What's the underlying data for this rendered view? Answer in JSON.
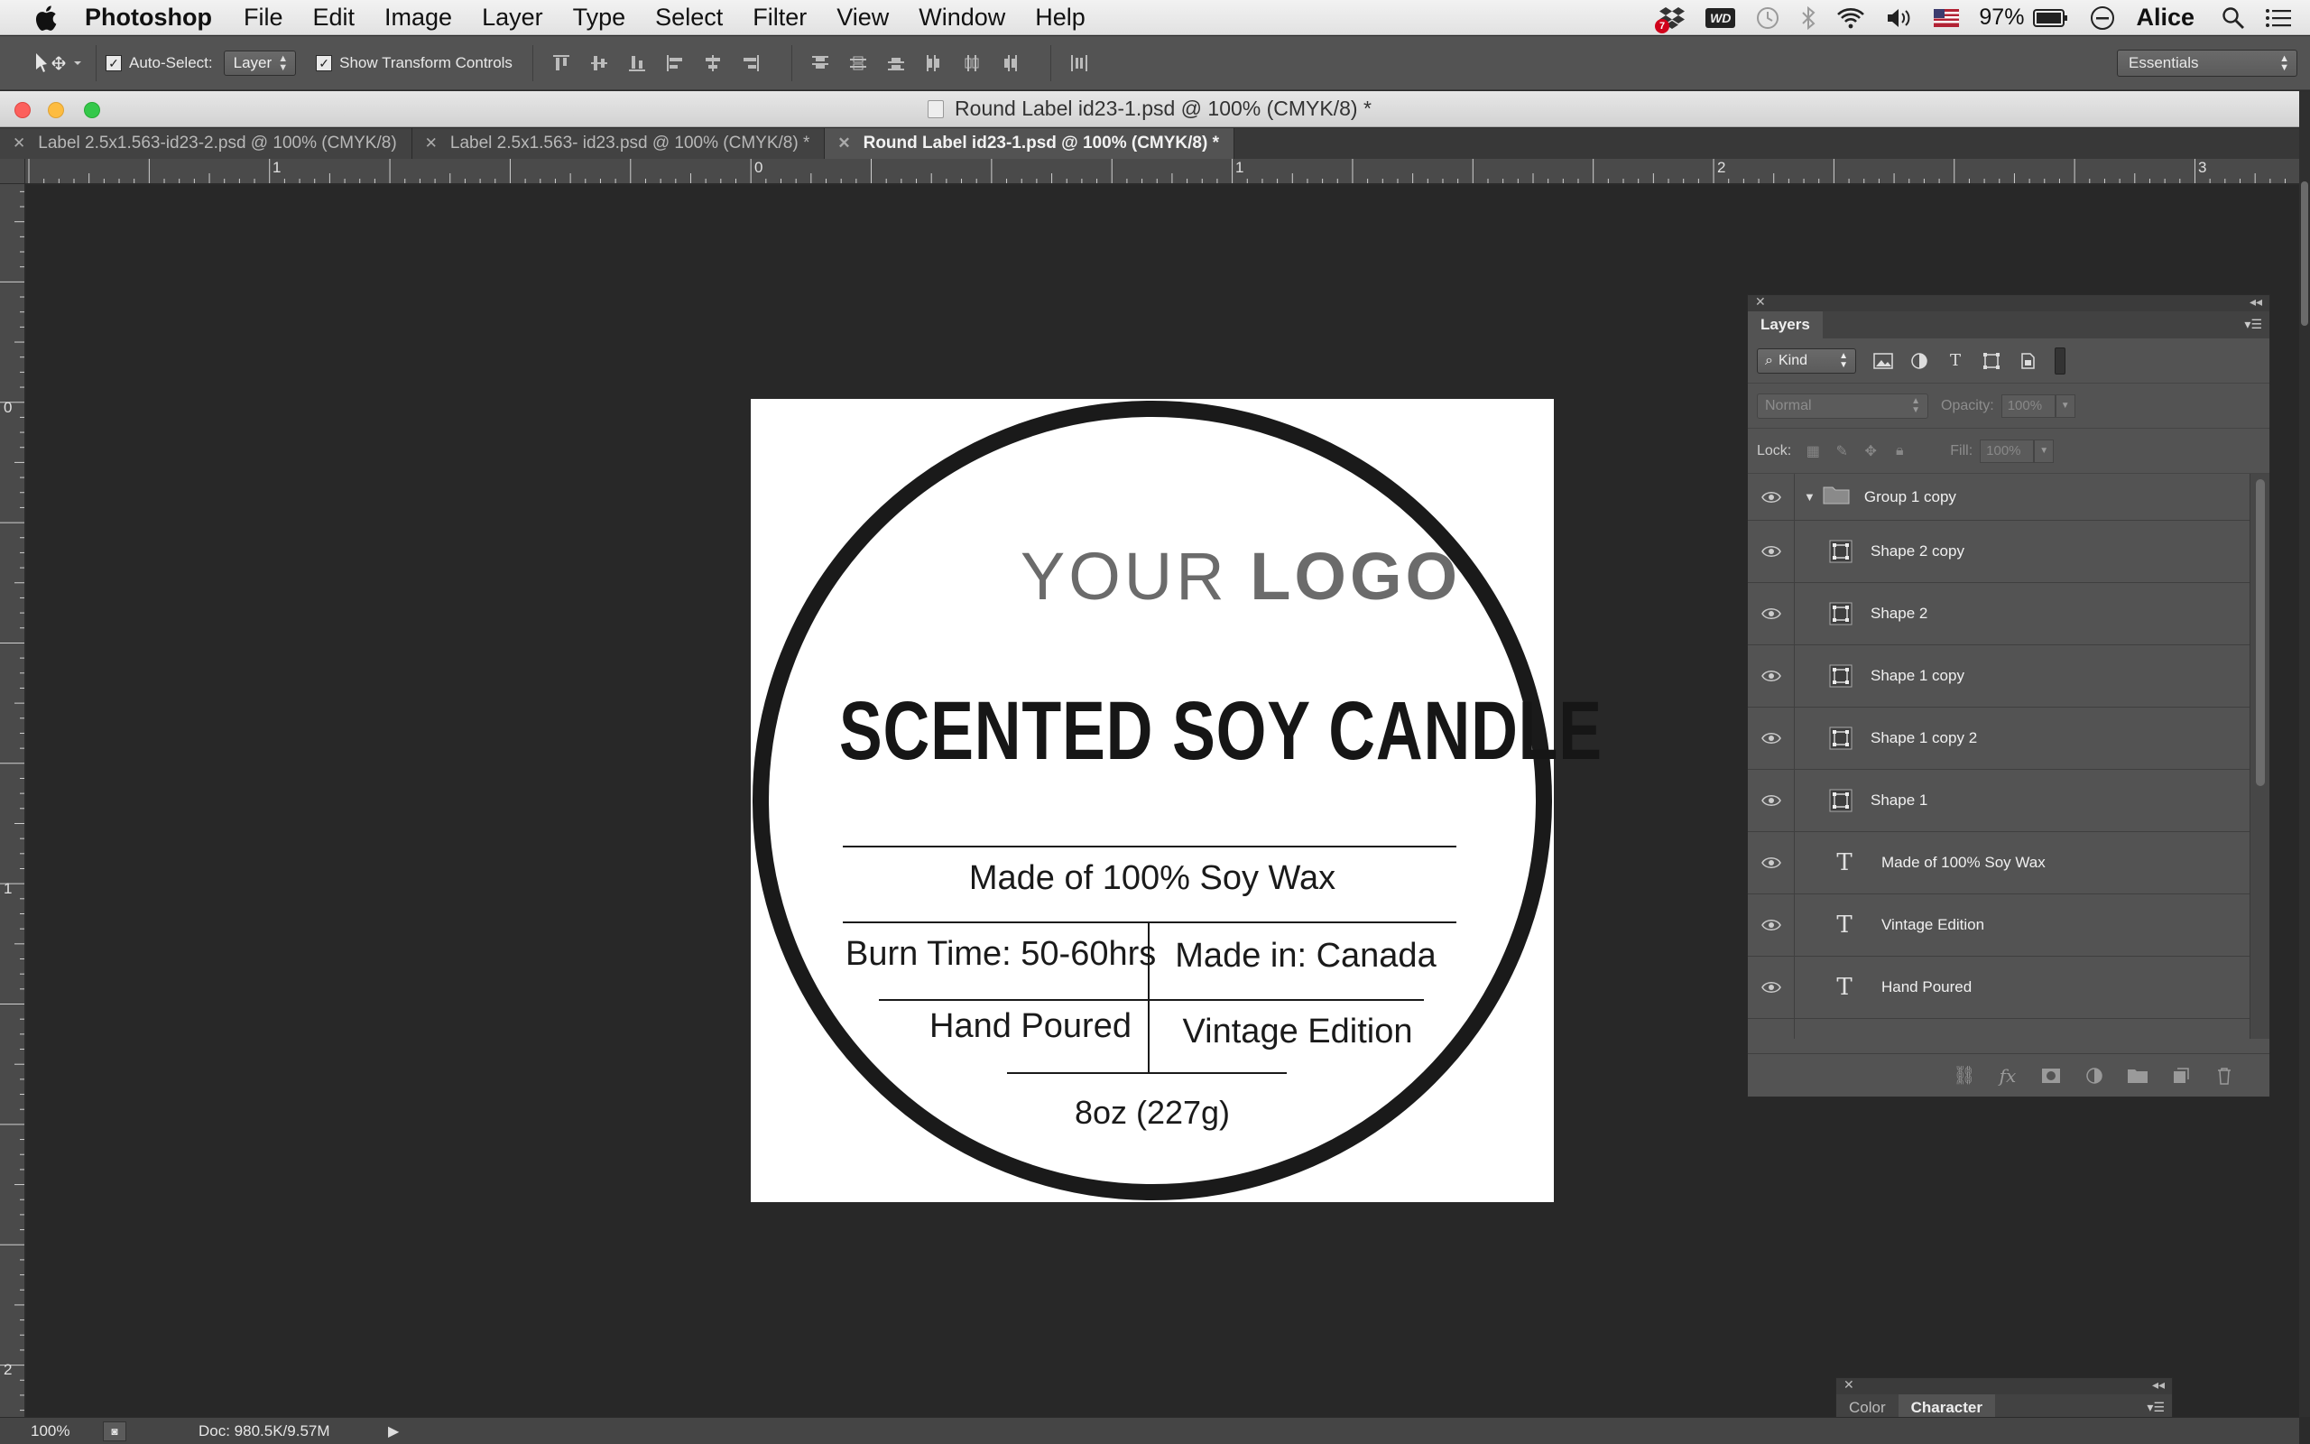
{
  "menubar": {
    "app_name": "Photoshop",
    "items": [
      "File",
      "Edit",
      "Image",
      "Layer",
      "Type",
      "Select",
      "Filter",
      "View",
      "Window",
      "Help"
    ],
    "status": {
      "battery_percent": "97%",
      "user": "Alice",
      "notification_badge": "7",
      "wd_label": "WD"
    }
  },
  "options": {
    "auto_select_label": "Auto-Select:",
    "auto_select_value": "Layer",
    "transform_controls_label": "Show Transform Controls",
    "workspace": "Essentials"
  },
  "document": {
    "window_title": "Round Label id23-1.psd @ 100% (CMYK/8) *",
    "tabs": [
      {
        "label": "Label 2.5x1.563-id23-2.psd @ 100% (CMYK/8)",
        "active": false
      },
      {
        "label": "Label 2.5x1.563- id23.psd @ 100% (CMYK/8) *",
        "active": false
      },
      {
        "label": "Round Label id23-1.psd @ 100% (CMYK/8) *",
        "active": true
      }
    ],
    "ruler_h": [
      "1",
      "0",
      "1",
      "2",
      "3"
    ],
    "ruler_v": [
      "0",
      "1",
      "2"
    ]
  },
  "label": {
    "logo_light": "YOUR",
    "logo_bold": "LOGO",
    "title": "SCENTED SOY CANDLE",
    "wax": "Made of 100% Soy Wax",
    "burn_time": "Burn Time: 50-60hrs",
    "made_in": "Made in: Canada",
    "hand_poured": "Hand Poured",
    "edition": "Vintage Edition",
    "weight": "8oz (227g)"
  },
  "layers_panel": {
    "tab": "Layers",
    "kind": "Kind",
    "blend_mode": "Normal",
    "opacity_label": "Opacity:",
    "opacity_value": "100%",
    "lock_label": "Lock:",
    "fill_label": "Fill:",
    "fill_value": "100%",
    "group_name": "Group 1 copy",
    "shape_layers": [
      "Shape 2 copy",
      "Shape 2",
      "Shape 1 copy",
      "Shape 1 copy 2",
      "Shape 1"
    ],
    "text_layers": [
      "Made of 100% Soy Wax",
      "Vintage Edition",
      "Hand Poured",
      "8oz (227g)"
    ]
  },
  "bottom_panel": {
    "tabs": [
      "Color",
      "Character"
    ]
  },
  "statusbar": {
    "zoom": "100%",
    "doc_info": "Doc: 980.5K/9.57M"
  }
}
